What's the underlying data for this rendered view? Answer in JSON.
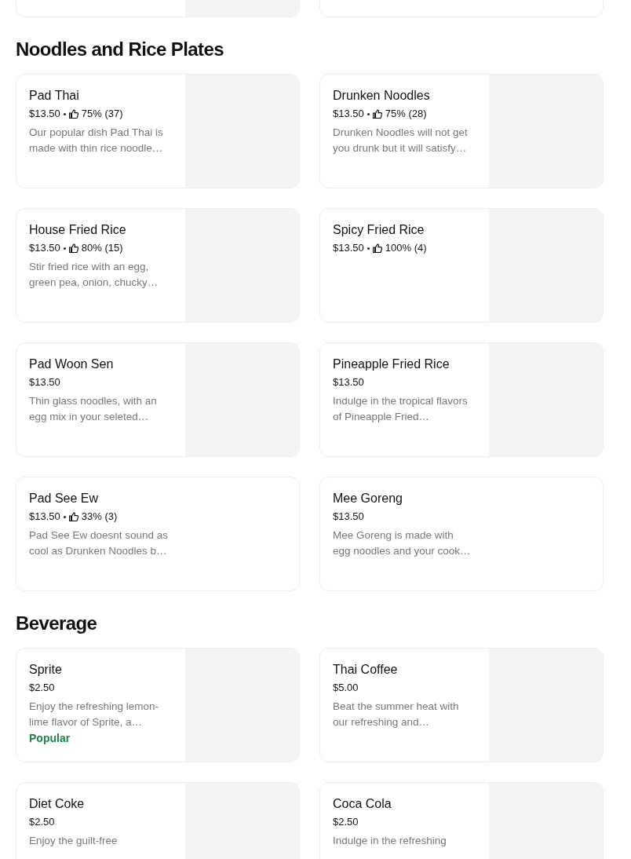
{
  "previous_section_cards": [
    {
      "kind": "with_image"
    },
    {
      "kind": "text_only"
    }
  ],
  "sections": [
    {
      "title": "Noodles and Rice Plates",
      "items": [
        {
          "kind": "with_image",
          "name": "Pad Thai",
          "price": "$13.50",
          "rating": "75% (37)",
          "description": "Our popular dish Pad Thai is made with thin rice noodle…"
        },
        {
          "kind": "with_image",
          "name": "Drunken Noodles",
          "price": "$13.50",
          "rating": "75% (28)",
          "description": "Drunken Noodles will not get you drunk but it will satisfy…"
        },
        {
          "kind": "with_image",
          "name": "House Fried Rice",
          "price": "$13.50",
          "rating": "80% (15)",
          "description": "Stir fried rice with an egg, green pea, onion, chucky…"
        },
        {
          "kind": "with_image",
          "name": "Spicy Fried Rice",
          "price": "$13.50",
          "rating": "100% (4)"
        },
        {
          "kind": "with_image",
          "name": "Pad Woon Sen",
          "price": "$13.50",
          "description": "Thin glass noodles, with an egg mix in your seleted…"
        },
        {
          "kind": "with_image",
          "name": "Pineapple Fried Rice",
          "price": "$13.50",
          "description": "Indulge in the tropical flavors of Pineapple Fried…"
        },
        {
          "kind": "text_only",
          "name": "Pad See Ew",
          "price": "$13.50",
          "rating": "33% (3)",
          "description": "Pad See Ew doesnt sound as cool as Drunken Noodles b…"
        },
        {
          "kind": "text_only",
          "name": "Mee Goreng",
          "price": "$13.50",
          "description": "Mee Goreng is made with egg noodles and your cook…"
        }
      ]
    },
    {
      "title": "Beverage",
      "items": [
        {
          "kind": "with_image",
          "name": "Sprite",
          "price": "$2.50",
          "description": "Enjoy the refreshing lemon-lime flavor of Sprite, a…",
          "badge": "Popular"
        },
        {
          "kind": "with_image",
          "name": "Thai Coffee",
          "price": "$5.00",
          "description": "Beat the summer heat with our refreshing and…"
        },
        {
          "kind": "with_image",
          "name": "Diet Coke",
          "price": "$2.50",
          "description": "Enjoy the guilt-free"
        },
        {
          "kind": "with_image",
          "name": "Coca Cola",
          "price": "$2.50",
          "description": "Indulge in the refreshing"
        }
      ]
    }
  ]
}
